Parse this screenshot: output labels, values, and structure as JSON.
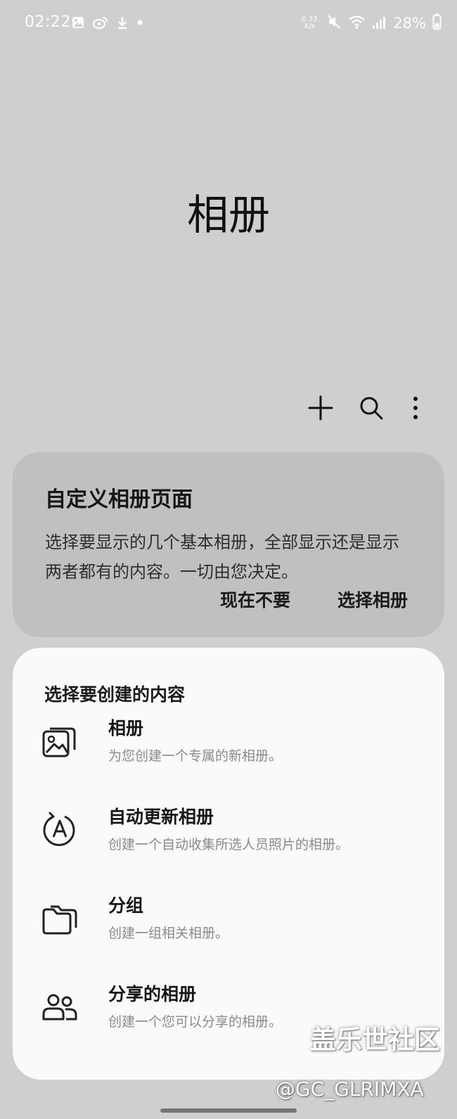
{
  "status_bar": {
    "time": "02:22",
    "net_speed_value": "0.33",
    "net_speed_unit": "K/s",
    "battery": "28%",
    "left_icons": [
      "gallery-icon",
      "weibo-icon",
      "download-icon",
      "dot-icon"
    ],
    "right_icons": [
      "mute-icon",
      "wifi-icon",
      "signal-icon",
      "battery-icon"
    ]
  },
  "page": {
    "title": "相册"
  },
  "toolbar": {
    "actions": [
      "plus-icon",
      "search-icon",
      "more-icon"
    ]
  },
  "customize_card": {
    "title": "自定义相册页面",
    "description": "选择要显示的几个基本相册，全部显示还是显示两者都有的内容。一切由您决定。",
    "not_now_label": "现在不要",
    "select_albums_label": "选择相册"
  },
  "create_sheet": {
    "title": "选择要创建的内容",
    "options": [
      {
        "title": "相册",
        "description": "为您创建一个专属的新相册。",
        "icon": "album-icon"
      },
      {
        "title": "自动更新相册",
        "description": "创建一个自动收集所选人员照片的相册。",
        "icon": "auto-update-icon"
      },
      {
        "title": "分组",
        "description": "创建一组相关相册。",
        "icon": "folder-group-icon"
      },
      {
        "title": "分享的相册",
        "description": "创建一个您可以分享的相册。",
        "icon": "shared-people-icon"
      }
    ]
  },
  "watermark": {
    "brand": "盖乐世社区",
    "handle": "@GC_GLRIMXA"
  },
  "colors": {
    "background": "#cfcfcf",
    "card": "#c0c0c0",
    "sheet": "#fafafa",
    "text": "#161616",
    "secondary_text": "#8a8a8a"
  }
}
